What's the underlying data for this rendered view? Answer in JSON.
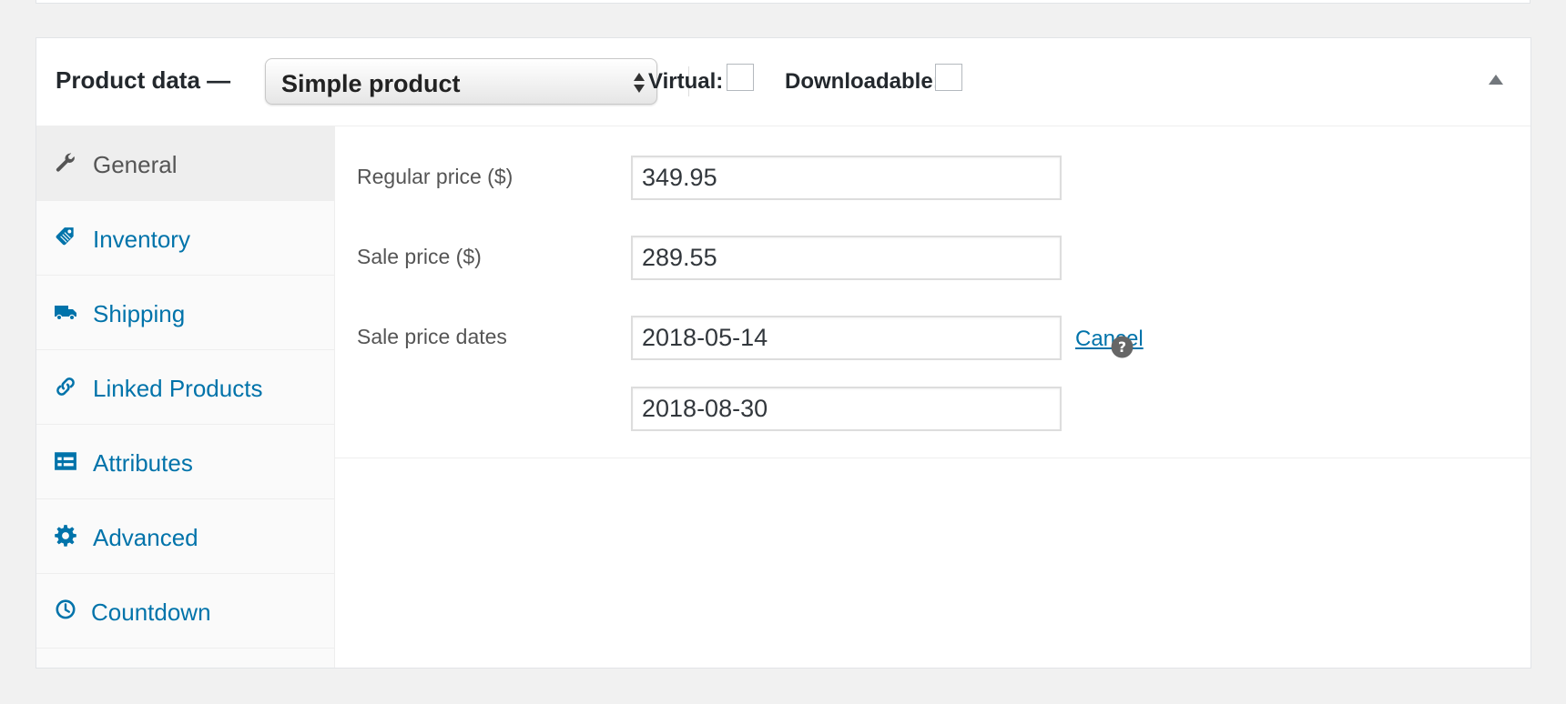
{
  "product_data": {
    "title": "Product data —",
    "product_type": "Simple product",
    "virtual_label": "Virtual:",
    "downloadable_label": "Downloadable:"
  },
  "tabs": [
    {
      "label": "General",
      "icon": "wrench-icon",
      "active": true
    },
    {
      "label": "Inventory",
      "icon": "tag-icon",
      "active": false
    },
    {
      "label": "Shipping",
      "icon": "truck-icon",
      "active": false
    },
    {
      "label": "Linked Products",
      "icon": "link-icon",
      "active": false
    },
    {
      "label": "Attributes",
      "icon": "list-card-icon",
      "active": false
    },
    {
      "label": "Advanced",
      "icon": "gear-icon",
      "active": false
    },
    {
      "label": "Countdown",
      "icon": "clock-icon",
      "active": false
    }
  ],
  "fields": {
    "regular_price_label": "Regular price ($)",
    "regular_price_value": "349.95",
    "sale_price_label": "Sale price ($)",
    "sale_price_value": "289.55",
    "sale_dates_label": "Sale price dates",
    "sale_date_from": "2018-05-14",
    "sale_date_to": "2018-08-30",
    "cancel_label": "Cancel"
  },
  "colors": {
    "link": "#0073aa",
    "active_tab_bg": "#eeeeee",
    "tab_bg": "#fafafa"
  }
}
